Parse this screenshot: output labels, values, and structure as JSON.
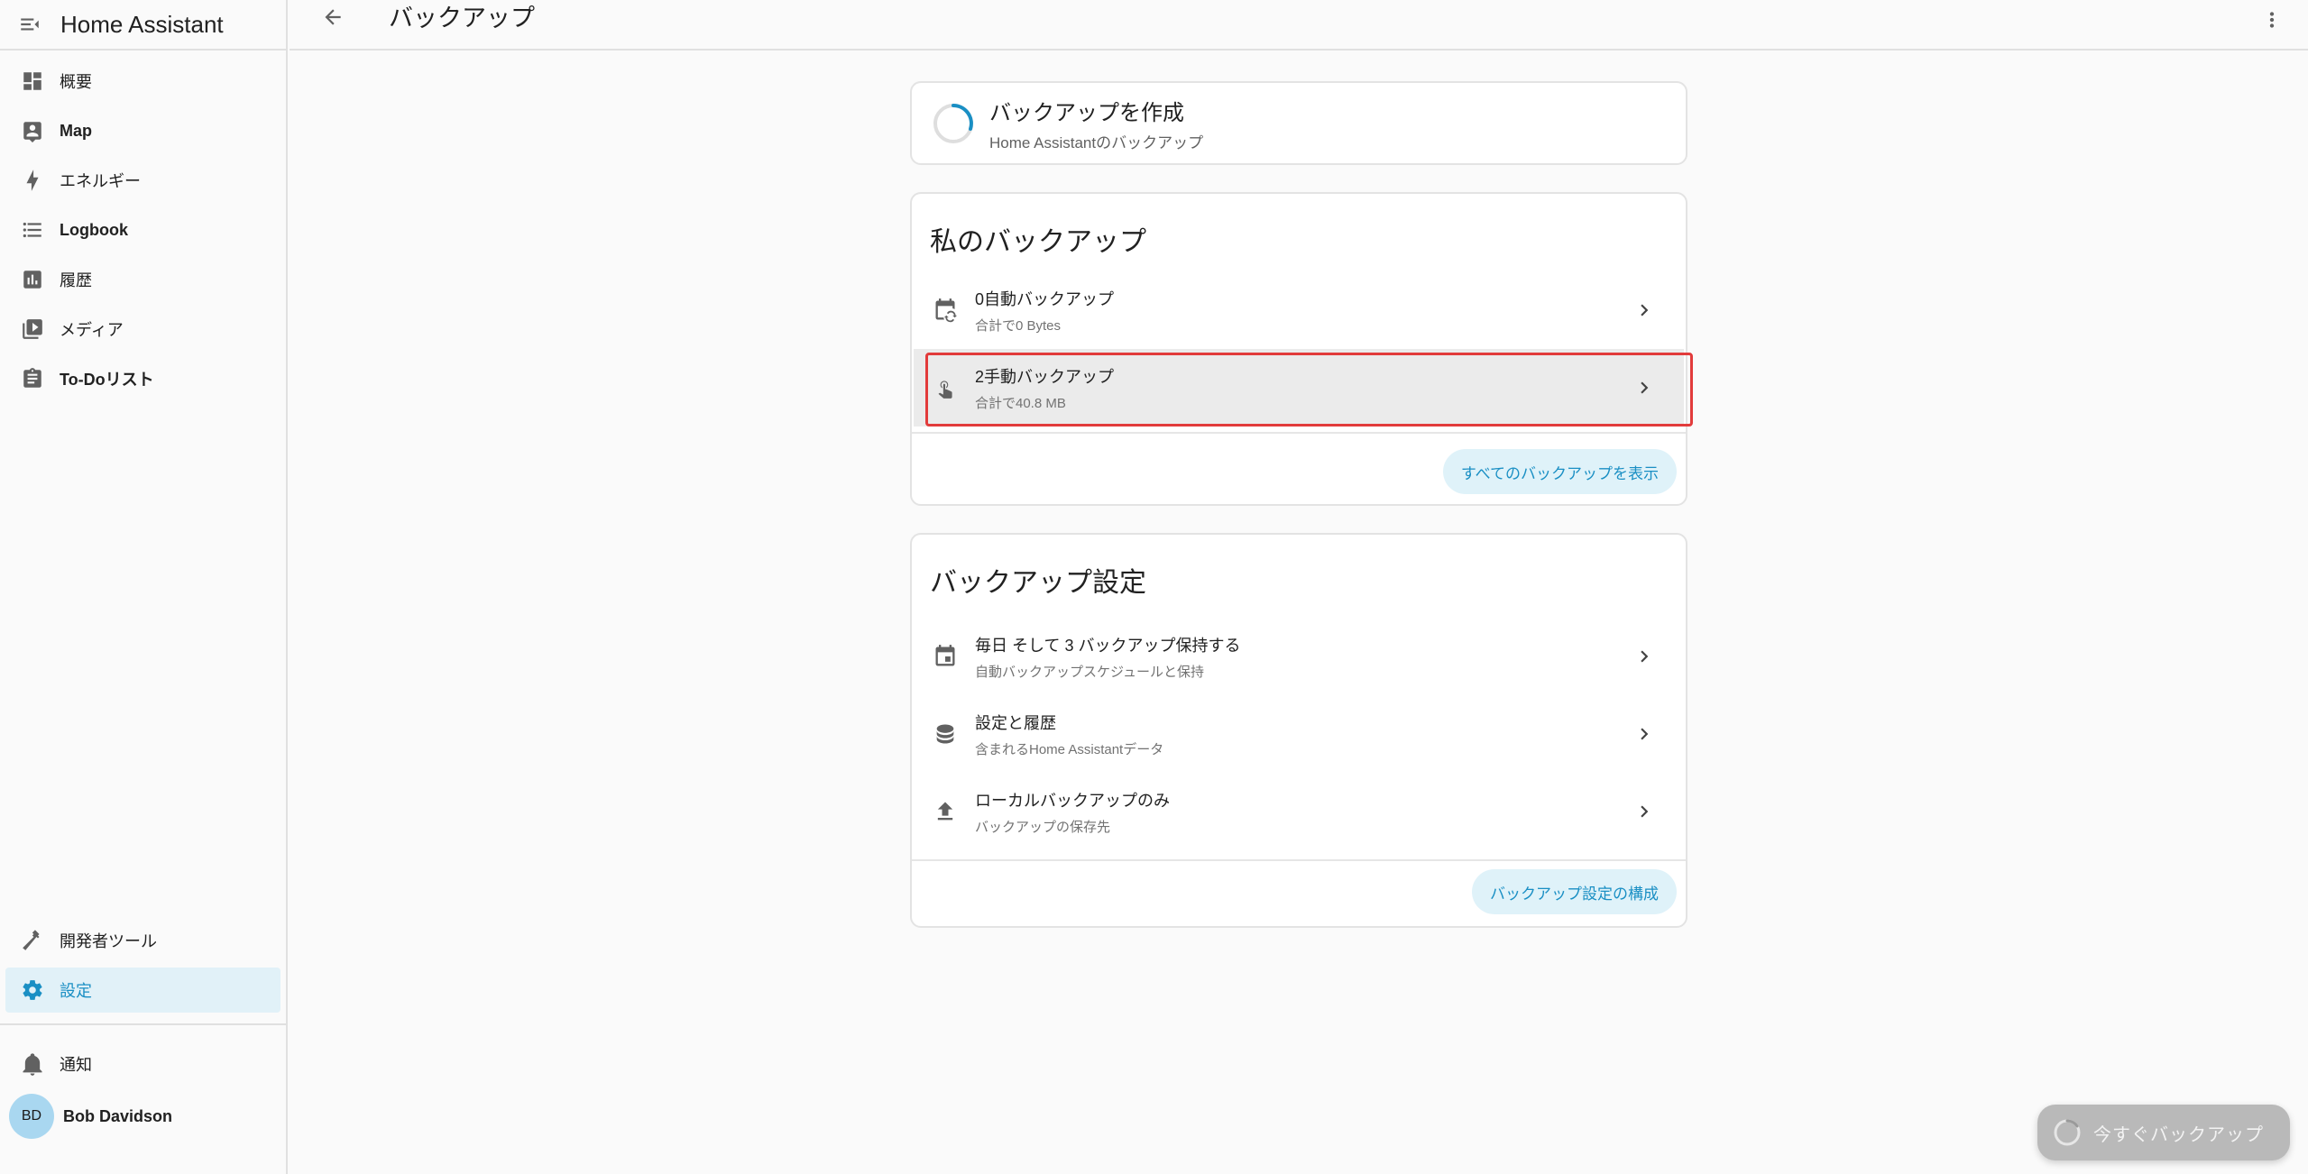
{
  "app": {
    "title": "Home Assistant"
  },
  "sidebar": {
    "items": [
      {
        "label": "概要",
        "icon": "dashboard-icon",
        "bold": false
      },
      {
        "label": "Map",
        "icon": "map-account-icon",
        "bold": true
      },
      {
        "label": "エネルギー",
        "icon": "lightning-bolt-icon",
        "bold": false
      },
      {
        "label": "Logbook",
        "icon": "format-list-bulleted-icon",
        "bold": true
      },
      {
        "label": "履歴",
        "icon": "chart-box-icon",
        "bold": false
      },
      {
        "label": "メディア",
        "icon": "play-box-multiple-icon",
        "bold": false
      },
      {
        "label": "To-Doリスト",
        "icon": "clipboard-list-icon",
        "bold": true
      }
    ],
    "bottom_items": [
      {
        "label": "開発者ツール",
        "icon": "hammer-icon"
      },
      {
        "label": "設定",
        "icon": "cog-icon",
        "active": true
      }
    ],
    "notifications_label": "通知",
    "user": {
      "initials": "BD",
      "name": "Bob Davidson"
    }
  },
  "header": {
    "title": "バックアップ"
  },
  "create_card": {
    "title": "バックアップを作成",
    "subtitle": "Home Assistantのバックアップ"
  },
  "my_backups": {
    "title": "私のバックアップ",
    "rows": [
      {
        "title": "0自動バックアップ",
        "subtitle": "合計で0 Bytes",
        "icon": "calendar-sync-icon"
      },
      {
        "title": "2手動バックアップ",
        "subtitle": "合計で40.8 MB",
        "icon": "gesture-tap-icon",
        "highlighted": true
      }
    ],
    "show_all_label": "すべてのバックアップを表示"
  },
  "backup_settings": {
    "title": "バックアップ設定",
    "rows": [
      {
        "title": "毎日 そして 3 バックアップ保持する",
        "subtitle": "自動バックアップスケジュールと保持",
        "icon": "calendar-icon"
      },
      {
        "title": "設定と履歴",
        "subtitle": "含まれるHome Assistantデータ",
        "icon": "database-icon"
      },
      {
        "title": "ローカルバックアップのみ",
        "subtitle": "バックアップの保存先",
        "icon": "upload-icon"
      }
    ],
    "configure_label": "バックアップ設定の構成"
  },
  "fab": {
    "label": "今すぐバックアップ"
  },
  "colors": {
    "accent": "#1a8fc4",
    "accent_bg": "#dff2f9",
    "highlight_border": "#e23b3b",
    "icon": "#616161"
  }
}
